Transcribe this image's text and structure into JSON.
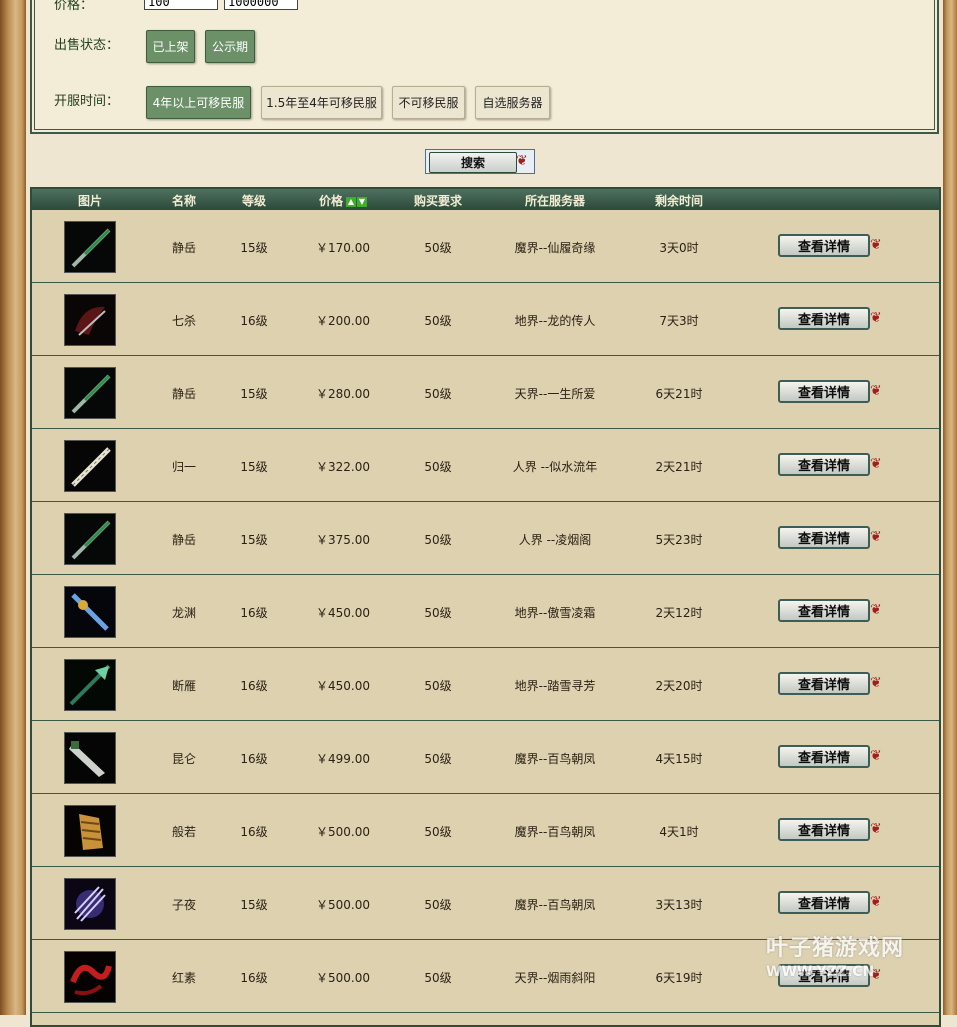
{
  "filters": {
    "price_label": "价格：",
    "price_min": "100",
    "price_max": "1000000",
    "status_label": "出售状态：",
    "status_options": [
      "已上架",
      "公示期"
    ],
    "server_time_label": "开服时间：",
    "server_time_options": [
      "4年以上可移民服",
      "1.5年至4年可移民服",
      "不可移民服",
      "自选服务器"
    ],
    "search_label": "搜索"
  },
  "table": {
    "headers": [
      "图片",
      "名称",
      "等级",
      "价格",
      "购买要求",
      "所在服务器",
      "剩余时间"
    ],
    "detail_label": "查看详情",
    "rows": [
      {
        "name": "静岳",
        "level": "15级",
        "price": "￥170.00",
        "req": "50级",
        "server": "魔界--仙履奇缘",
        "time": "3天0时",
        "icon": "green-blade-icon"
      },
      {
        "name": "七杀",
        "level": "16级",
        "price": "￥200.00",
        "req": "50级",
        "server": "地界--龙的传人",
        "time": "7天3时",
        "icon": "dark-axe-icon"
      },
      {
        "name": "静岳",
        "level": "15级",
        "price": "￥280.00",
        "req": "50级",
        "server": "天界--一生所爱",
        "time": "6天21时",
        "icon": "green-blade-icon"
      },
      {
        "name": "归一",
        "level": "15级",
        "price": "￥322.00",
        "req": "50级",
        "server": "人界 --似水流年",
        "time": "2天21时",
        "icon": "white-flute-icon"
      },
      {
        "name": "静岳",
        "level": "15级",
        "price": "￥375.00",
        "req": "50级",
        "server": "人界 --凌烟阁",
        "time": "5天23时",
        "icon": "green-blade-icon"
      },
      {
        "name": "龙渊",
        "level": "16级",
        "price": "￥450.00",
        "req": "50级",
        "server": "地界--傲雪凌霜",
        "time": "2天12时",
        "icon": "blue-sword-icon"
      },
      {
        "name": "断雁",
        "level": "16级",
        "price": "￥450.00",
        "req": "50级",
        "server": "地界--踏雪寻芳",
        "time": "2天20时",
        "icon": "jade-spear-icon"
      },
      {
        "name": "昆仑",
        "level": "16级",
        "price": "￥499.00",
        "req": "50级",
        "server": "魔界--百鸟朝凤",
        "time": "4天15时",
        "icon": "broad-blade-icon"
      },
      {
        "name": "般若",
        "level": "16级",
        "price": "￥500.00",
        "req": "50级",
        "server": "魔界--百鸟朝凤",
        "time": "4天1时",
        "icon": "golden-gauntlet-icon"
      },
      {
        "name": "子夜",
        "level": "15级",
        "price": "￥500.00",
        "req": "50级",
        "server": "魔界--百鸟朝凤",
        "time": "3天13时",
        "icon": "violet-claw-icon"
      },
      {
        "name": "红素",
        "level": "16级",
        "price": "￥500.00",
        "req": "50级",
        "server": "天界--烟雨斜阳",
        "time": "6天19时",
        "icon": "red-whip-icon"
      }
    ]
  },
  "watermark": {
    "line1": "叶子猪游戏网",
    "line2": "WWW.YZZ.CN"
  }
}
